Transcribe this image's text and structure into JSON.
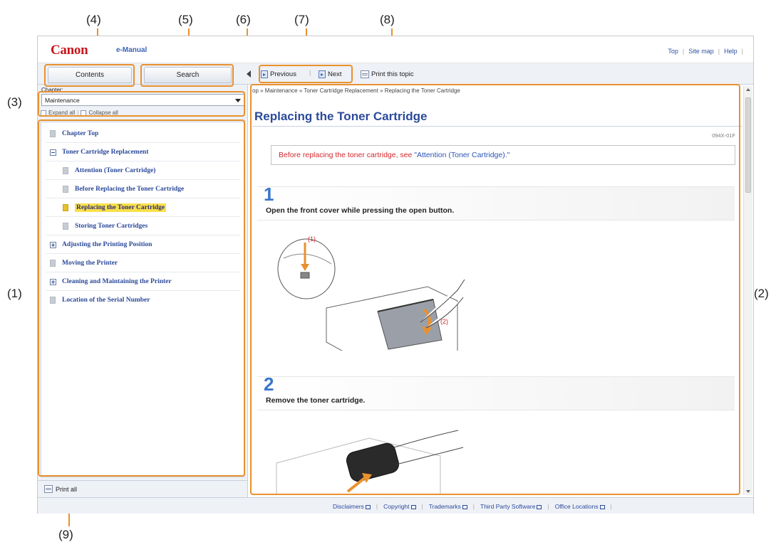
{
  "callouts": {
    "c4": "(4)",
    "c5": "(5)",
    "c6": "(6)",
    "c7": "(7)",
    "c8": "(8)",
    "c3": "(3)",
    "c1": "(1)",
    "c2": "(2)",
    "c9": "(9)"
  },
  "header": {
    "logo": "Canon",
    "product": "e-Manual",
    "links": [
      "Top",
      "Site map",
      "Help"
    ]
  },
  "toolbar": {
    "tab_contents": "Contents",
    "tab_search": "Search",
    "previous": "Previous",
    "next": "Next",
    "print_topic": "Print this topic"
  },
  "sidebar": {
    "chapter_label": "Chapter:",
    "chapter_value": "Maintenance",
    "expand_all": "Expand all",
    "collapse_all": "Collapse all",
    "items": [
      {
        "label": "Chapter Top"
      },
      {
        "label": "Toner Cartridge Replacement"
      },
      {
        "label": "Attention (Toner Cartridge)"
      },
      {
        "label": "Before Replacing the Toner Cartridge"
      },
      {
        "label": "Replacing the Toner Cartridge"
      },
      {
        "label": "Storing Toner Cartridges"
      },
      {
        "label": "Adjusting the Printing Position"
      },
      {
        "label": "Moving the Printer"
      },
      {
        "label": "Cleaning and Maintaining the Printer"
      },
      {
        "label": "Location of the Serial Number"
      }
    ],
    "print_all": "Print all"
  },
  "content": {
    "breadcrumb": "op » Maintenance » Toner Cartridge Replacement » Replacing the Toner Cartridge",
    "title": "Replacing the Toner Cartridge",
    "doc_id": "094X-01F",
    "attention_prefix": "Before replacing the toner cartridge, see ",
    "attention_link": "\"Attention (Toner Cartridge).\"",
    "steps": [
      {
        "number": "1",
        "text": "Open the front cover while pressing the open button."
      },
      {
        "number": "2",
        "text": "Remove the toner cartridge."
      }
    ],
    "illus_labels": {
      "a": "(1)",
      "b": "(2)"
    }
  },
  "footer": {
    "links": [
      "Disclaimers",
      "Copyright",
      "Trademarks",
      "Third Party Software",
      "Office Locations"
    ]
  }
}
